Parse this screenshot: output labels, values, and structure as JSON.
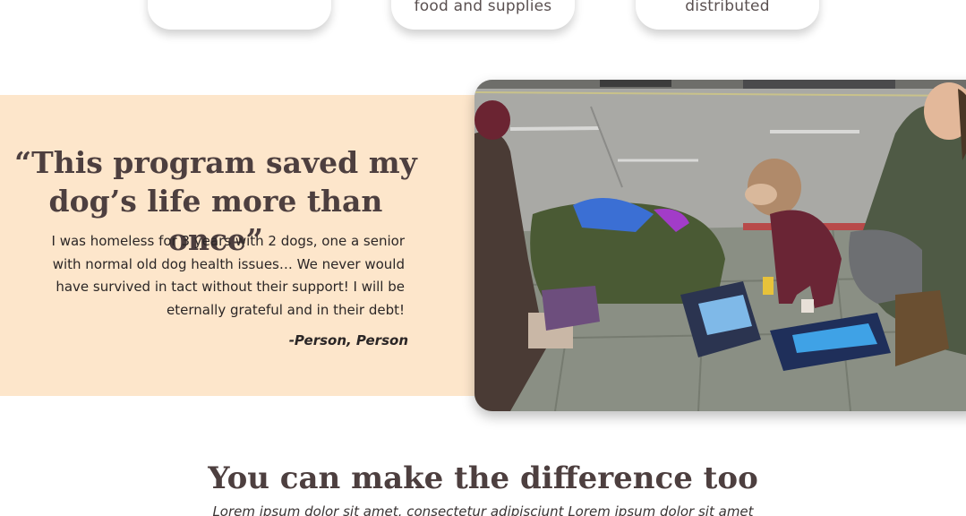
{
  "stats": {
    "cards": [
      {
        "label": ""
      },
      {
        "label": "food and supplies"
      },
      {
        "label": "distributed"
      }
    ]
  },
  "testimonial": {
    "quote": "“This program saved my dog’s life more than once”",
    "body": "I was homeless for 3 years with 2 dogs, one a senior with normal old dog health issues… We never would have survived in tact without their support! I will be eternally grateful and in their debt!",
    "author": "-Person, Person",
    "band_color": "#fde6cb"
  },
  "cta": {
    "title": "You can make the difference too",
    "subtitle": "Lorem ipsum dolor sit amet, consectetur adipisciunt Lorem ipsum dolor sit amet"
  },
  "colors": {
    "heading": "#4d3f3f",
    "text": "#2b2626",
    "background": "#ffffff"
  }
}
